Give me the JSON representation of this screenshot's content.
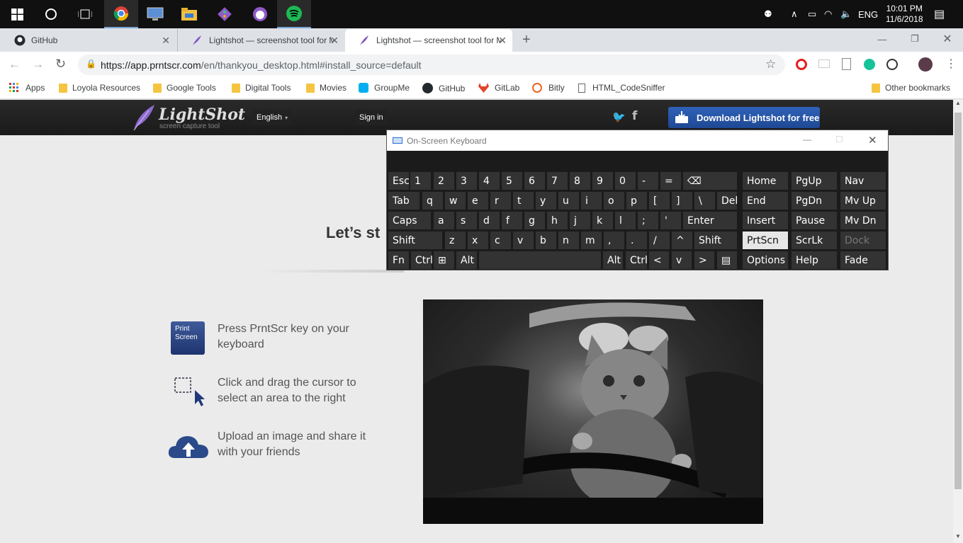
{
  "taskbar": {
    "apps": [
      "windows-start-icon",
      "cortana-circle-icon",
      "task-view-icon",
      "chrome-icon",
      "remote-desktop-icon",
      "file-explorer-icon",
      "git-icon",
      "github-desktop-icon",
      "spotify-icon"
    ],
    "lang": "ENG",
    "time": "10:01 PM",
    "date": "11/6/2018"
  },
  "tabs": [
    {
      "title": "GitHub"
    },
    {
      "title": "Lightshot — screenshot tool for M"
    },
    {
      "title": "Lightshot — screenshot tool for M"
    }
  ],
  "omnibox": {
    "url_host": "https://app.prntscr.com",
    "url_path": "/en/thankyou_desktop.html#install_source=default"
  },
  "bookmarks": [
    "Apps",
    "Loyola Resources",
    "Google Tools",
    "Digital Tools",
    "Movies",
    "GroupMe",
    "GitHub",
    "GitLab",
    "Bitly",
    "HTML_CodeSniffer"
  ],
  "other_bookmarks": "Other bookmarks",
  "site": {
    "logo": "LightShot",
    "logo_sub": "screen capture tool",
    "language": "English",
    "signin": "Sign in",
    "download": "Download Lightshot for free",
    "headline": "Let’s st",
    "print_key": "Print Screen",
    "step1": "Press PrntScr key on your keyboard",
    "step2": "Click and drag the cursor to select an area to the right",
    "step3": "Upload an image and share it with your friends"
  },
  "osk": {
    "title": "On-Screen Keyboard",
    "rows": [
      [
        "Esc",
        "1",
        "2",
        "3",
        "4",
        "5",
        "6",
        "7",
        "8",
        "9",
        "0",
        "-",
        "=",
        "⌫"
      ],
      [
        "Tab",
        "q",
        "w",
        "e",
        "r",
        "t",
        "y",
        "u",
        "i",
        "o",
        "p",
        "[",
        "]",
        "\\",
        "Del"
      ],
      [
        "Caps",
        "a",
        "s",
        "d",
        "f",
        "g",
        "h",
        "j",
        "k",
        "l",
        ";",
        "'",
        "Enter"
      ],
      [
        "Shift",
        "z",
        "x",
        "c",
        "v",
        "b",
        "n",
        "m",
        ",",
        ".",
        "/",
        "^",
        "Shift"
      ],
      [
        "Fn",
        "Ctrl",
        "⊞",
        "Alt",
        "",
        "Alt",
        "Ctrl",
        "<",
        "v",
        ">",
        "▤"
      ]
    ],
    "side": [
      [
        "Home",
        "PgUp",
        "Nav"
      ],
      [
        "End",
        "PgDn",
        "Mv Up"
      ],
      [
        "Insert",
        "Pause",
        "Mv Dn"
      ],
      [
        "PrtScn",
        "ScrLk",
        "Dock"
      ],
      [
        "Options",
        "Help",
        "Fade"
      ]
    ]
  }
}
